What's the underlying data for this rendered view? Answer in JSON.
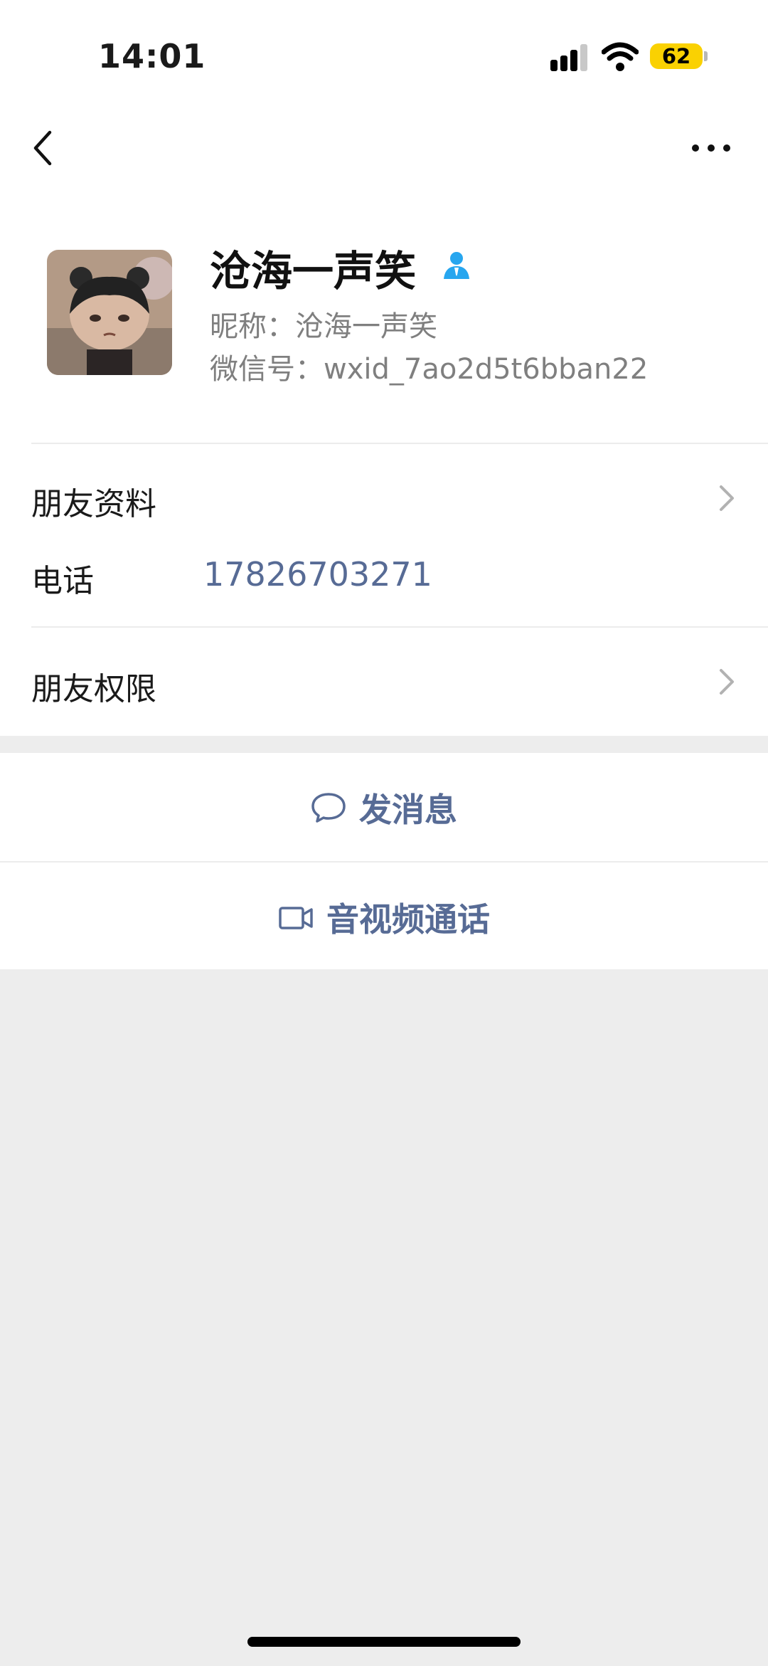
{
  "status_bar": {
    "time": "14:01",
    "battery": "62"
  },
  "profile": {
    "name": "沧海一声笑",
    "nickname_label": "昵称：",
    "nickname": "沧海一声笑",
    "wxid_label": "微信号：",
    "wxid": "wxid_7ao2d5t6bban22"
  },
  "rows": {
    "friend_info": "朋友资料",
    "phone_label": "电话",
    "phone_value": "17826703271",
    "friend_permissions": "朋友权限"
  },
  "actions": {
    "send_message": "发消息",
    "av_call": "音视频通话"
  },
  "colors": {
    "link": "#576b95",
    "battery": "#fad102",
    "contact_icon": "#27a6ef"
  },
  "icons": [
    "back-arrow-icon",
    "more-icon",
    "contact-person-icon",
    "chevron-right-icon",
    "chat-bubble-icon",
    "video-camera-icon"
  ]
}
